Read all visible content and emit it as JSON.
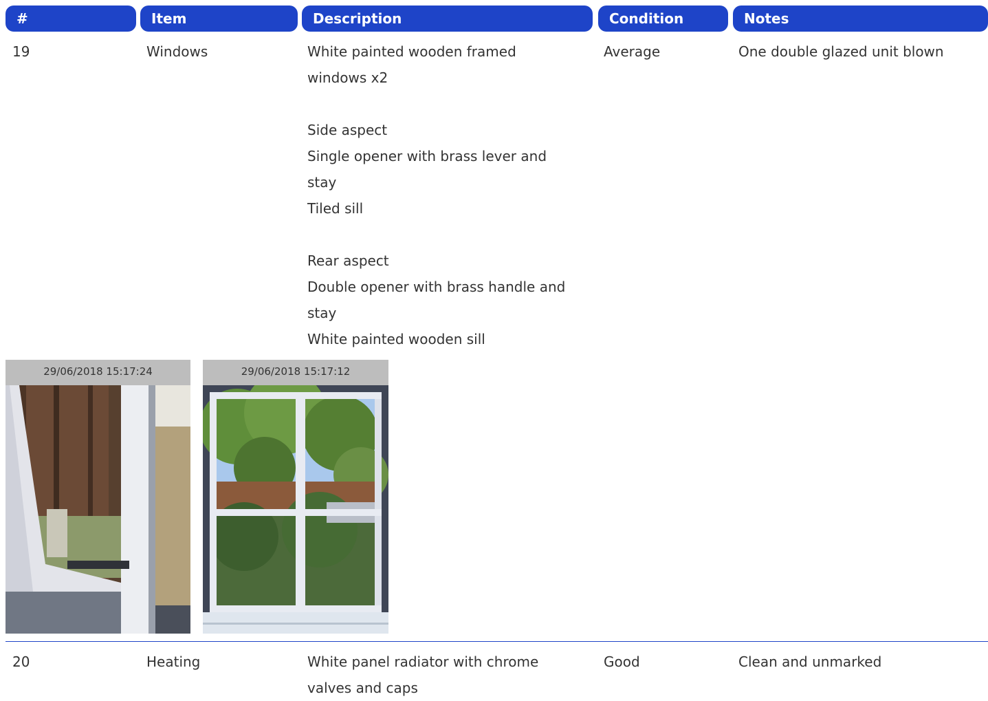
{
  "header": {
    "num": "#",
    "item": "Item",
    "description": "Description",
    "condition": "Condition",
    "notes": "Notes"
  },
  "rows": [
    {
      "num": "19",
      "item": "Windows",
      "description_lines": [
        "White painted wooden framed",
        "windows x2",
        "",
        "Side aspect",
        "Single opener with brass lever and",
        "stay",
        "Tiled sill",
        "",
        "Rear aspect",
        "Double opener with brass handle and",
        "stay",
        "White painted wooden sill"
      ],
      "condition": "Average",
      "notes": "One double glazed unit blown",
      "photos": [
        {
          "timestamp": "29/06/2018 15:17:24"
        },
        {
          "timestamp": "29/06/2018 15:17:12"
        }
      ]
    },
    {
      "num": "20",
      "item": "Heating",
      "description_lines": [
        "White panel radiator with chrome",
        "valves and caps"
      ],
      "condition": "Good",
      "notes": "Clean and unmarked"
    }
  ],
  "colors": {
    "header_bg": "#1e44c8",
    "text": "#333333",
    "stamp_bg": "#bdbdbd"
  }
}
